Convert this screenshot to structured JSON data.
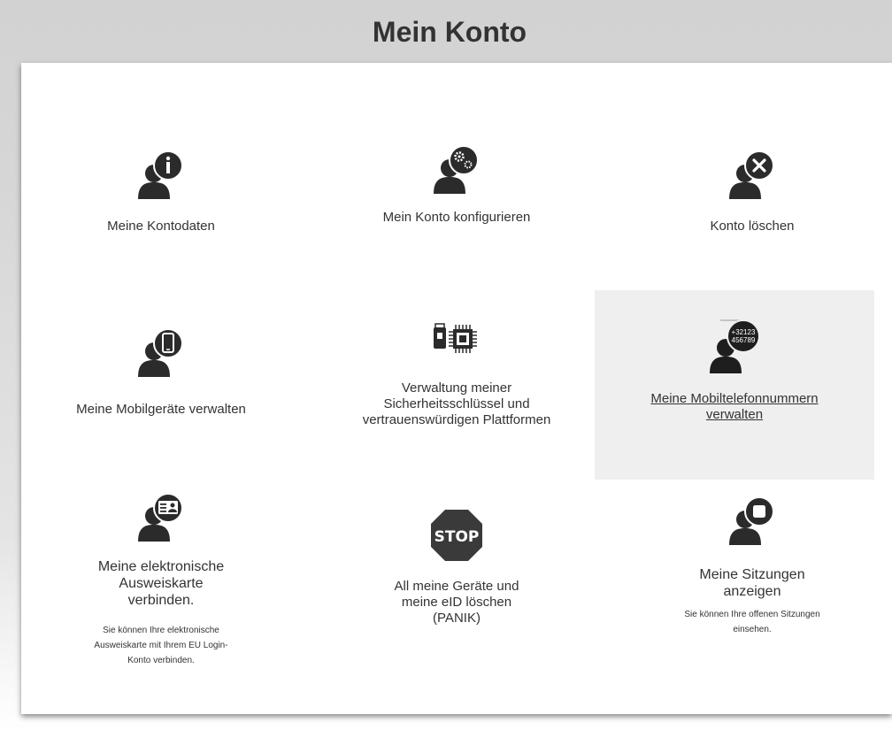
{
  "header": {
    "title": "Mein Konto"
  },
  "tiles": [
    {
      "label": "Meine Kontodaten",
      "icon": "user-info-icon"
    },
    {
      "label": "Mein Konto konfigurieren",
      "icon": "user-settings-icon"
    },
    {
      "label": "Konto löschen",
      "icon": "user-delete-icon"
    },
    {
      "label": "Meine Mobilgeräte verwalten",
      "icon": "user-mobile-icon"
    },
    {
      "label": "Verwaltung meiner Sicherheitsschlüssel und vertrauenswürdigen Plattformen",
      "icon": "security-key-chip-icon"
    },
    {
      "label": "Meine Mobiltelefonnummern verwalten",
      "icon": "user-phone-number-icon",
      "icon_text_1": "+32123",
      "icon_text_2": "456789"
    },
    {
      "label": "Meine elektronische Ausweiskarte verbinden.",
      "description": "Sie können Ihre elektronische Ausweiskarte mit Ihrem EU Login-Konto verbinden.",
      "icon": "user-id-card-icon"
    },
    {
      "label": "All meine Geräte und meine eID löschen (PANIK)",
      "icon": "stop-sign-icon",
      "icon_text": "STOP"
    },
    {
      "label": "Meine Sitzungen anzeigen",
      "description": "Sie können Ihre offenen Sitzungen einsehen.",
      "icon": "user-session-icon"
    }
  ]
}
